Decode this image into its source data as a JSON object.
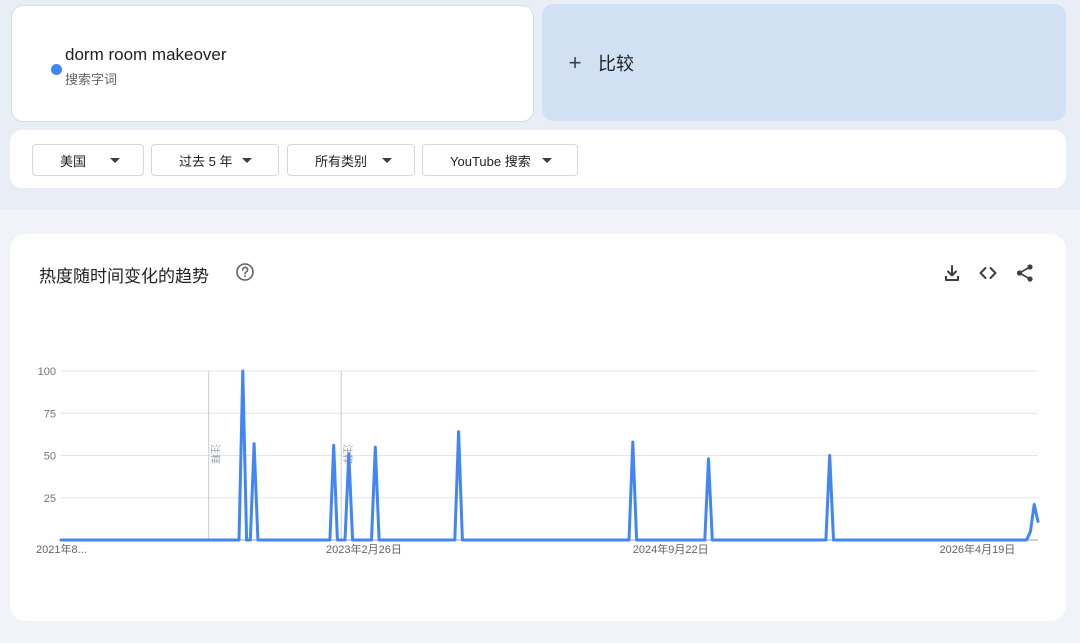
{
  "search_term": {
    "name": "dorm room makeover",
    "type_label": "搜索字词",
    "color": "#4285f4"
  },
  "compare": {
    "label": "比较"
  },
  "filters": [
    {
      "label": "美国"
    },
    {
      "label": "过去 5 年"
    },
    {
      "label": "所有类别"
    },
    {
      "label": "YouTube 搜索"
    }
  ],
  "chart_section": {
    "title": "热度随时间变化的趋势"
  },
  "icons": {
    "help": "help-circle-icon",
    "download": "download-icon",
    "embed": "code-icon",
    "share": "share-icon"
  },
  "chart_data": {
    "type": "line",
    "title": "热度随时间变化的趋势",
    "xlabel": "",
    "ylabel": "",
    "ylim": [
      0,
      100
    ],
    "yticks": [
      25,
      50,
      75,
      100
    ],
    "x_tick_labels": [
      "2021年8...",
      "2023年2月26日",
      "2024年9月22日",
      "2026年4月19日"
    ],
    "x_tick_index": [
      0,
      80,
      161,
      242
    ],
    "notes": [
      {
        "label": "注释",
        "index": 39
      },
      {
        "label": "注释",
        "index": 74
      }
    ],
    "grid": true,
    "legend": "none",
    "series": [
      {
        "color": "#4285f4",
        "points": [
          [
            0,
            0
          ],
          [
            47,
            0
          ],
          [
            48,
            100
          ],
          [
            49,
            0
          ],
          [
            50,
            0
          ],
          [
            51,
            57
          ],
          [
            52,
            0
          ],
          [
            71,
            0
          ],
          [
            72,
            56
          ],
          [
            73,
            0
          ],
          [
            75,
            0
          ],
          [
            76,
            51
          ],
          [
            77,
            0
          ],
          [
            82,
            0
          ],
          [
            83,
            55
          ],
          [
            84,
            0
          ],
          [
            104,
            0
          ],
          [
            105,
            64
          ],
          [
            106,
            0
          ],
          [
            150,
            0
          ],
          [
            151,
            58
          ],
          [
            152,
            0
          ],
          [
            170,
            0
          ],
          [
            171,
            48
          ],
          [
            172,
            0
          ],
          [
            202,
            0
          ],
          [
            203,
            50
          ],
          [
            204,
            0
          ],
          [
            255,
            0
          ],
          [
            256,
            5
          ],
          [
            257,
            21
          ],
          [
            258,
            11
          ]
        ]
      }
    ]
  }
}
